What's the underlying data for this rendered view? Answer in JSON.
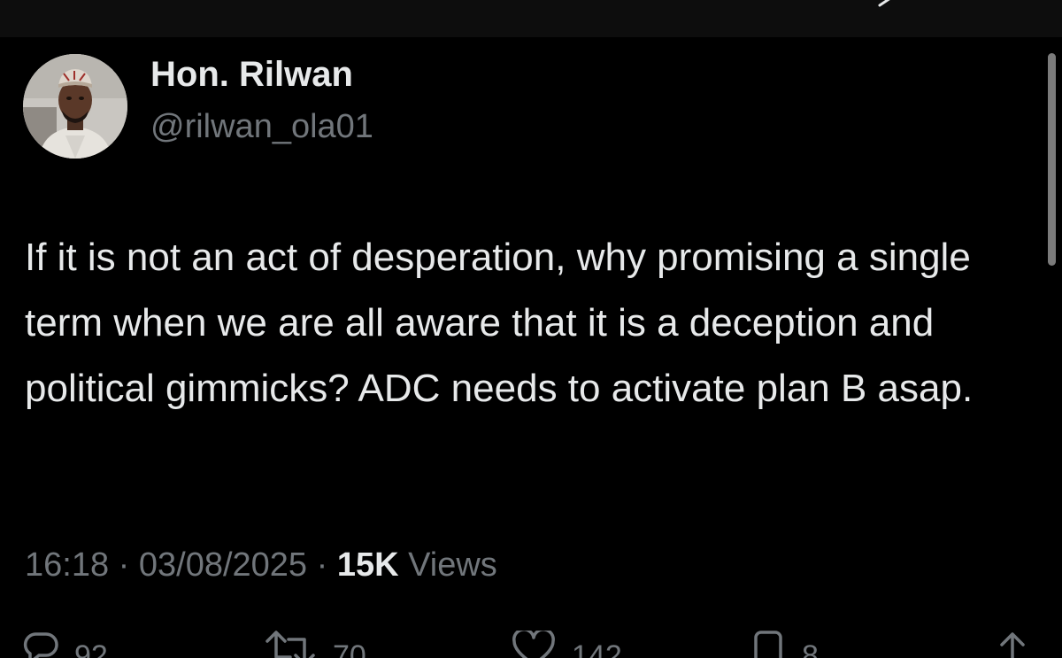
{
  "author": {
    "display_name": "Hon. Rilwan",
    "handle": "@rilwan_ola01"
  },
  "tweet": {
    "text": "If it is not an act of desperation, why promising a single term when we are all aware that it is a deception and political gimmicks? ADC needs to activate plan B asap."
  },
  "meta": {
    "time": "16:18",
    "separator": "·",
    "date": "03/08/2025",
    "views_count": "15K",
    "views_label": "Views"
  },
  "actions": {
    "replies": "92",
    "reposts": "70",
    "likes": "142",
    "bookmarks": "8"
  },
  "icons": {
    "reply": "reply-icon",
    "repost": "repost-icon",
    "like": "heart-icon",
    "bookmark": "bookmark-icon",
    "share": "share-icon"
  },
  "colors": {
    "background": "#000000",
    "primary_text": "#e7e9ea",
    "secondary_text": "#71767b"
  }
}
